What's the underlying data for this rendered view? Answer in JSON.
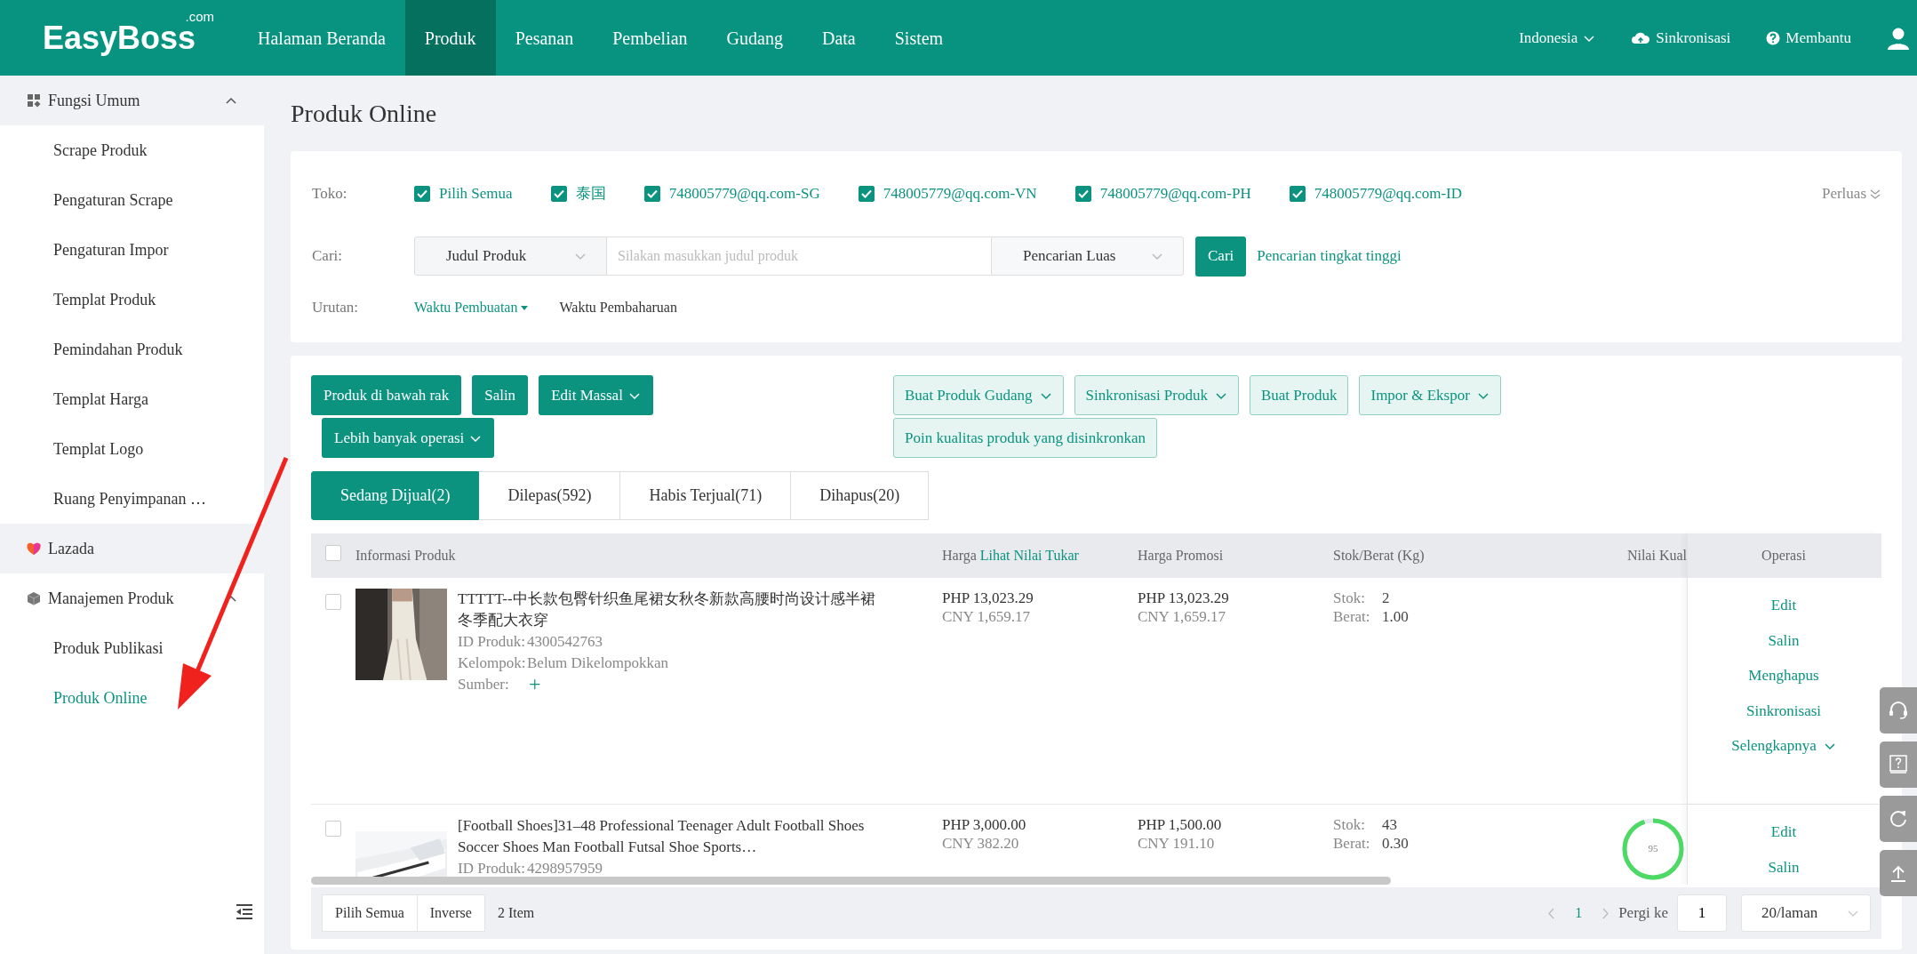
{
  "logo": {
    "text": "EasyBoss",
    "suffix": ".com"
  },
  "nav": [
    {
      "label": "Halaman Beranda",
      "selected": false
    },
    {
      "label": "Produk",
      "selected": true
    },
    {
      "label": "Pesanan",
      "selected": false
    },
    {
      "label": "Pembelian",
      "selected": false
    },
    {
      "label": "Gudang",
      "selected": false
    },
    {
      "label": "Data",
      "selected": false
    },
    {
      "label": "Sistem",
      "selected": false
    }
  ],
  "top_right": {
    "language": "Indonesia",
    "sync": "Sinkronisasi",
    "help": "Membantu"
  },
  "sidebar": {
    "groups": [
      {
        "label": "Fungsi Umum",
        "highlighted": true,
        "expanded": true,
        "children": [
          {
            "label": "Scrape Produk",
            "selected": false
          },
          {
            "label": "Pengaturan Scrape",
            "selected": false
          },
          {
            "label": "Pengaturan Impor",
            "selected": false
          },
          {
            "label": "Templat Produk",
            "selected": false
          },
          {
            "label": "Pemindahan Produk",
            "selected": false
          },
          {
            "label": "Templat Harga",
            "selected": false
          },
          {
            "label": "Templat Logo",
            "selected": false
          },
          {
            "label": "Ruang Penyimpanan …",
            "selected": false
          }
        ]
      },
      {
        "label": "Lazada",
        "highlighted": true
      },
      {
        "label": "Manajemen Produk",
        "highlighted": false,
        "expanded": true,
        "children": [
          {
            "label": "Produk Publikasi",
            "selected": false
          },
          {
            "label": "Produk Online",
            "selected": true
          }
        ]
      }
    ]
  },
  "page_title": "Produk Online",
  "filters": {
    "store_label": "Toko:",
    "stores": [
      {
        "label": "Pilih Semua",
        "checked": true
      },
      {
        "label": "泰国",
        "checked": true
      },
      {
        "label": "748005779@qq.com-SG",
        "checked": true
      },
      {
        "label": "748005779@qq.com-VN",
        "checked": true
      },
      {
        "label": "748005779@qq.com-PH",
        "checked": true
      },
      {
        "label": "748005779@qq.com-ID",
        "checked": true
      }
    ],
    "expand": "Perluas",
    "search_label": "Cari:",
    "field_select": "Judul Produk",
    "placeholder": "Silakan masukkan judul produk",
    "mode_select": "Pencarian Luas",
    "search_button": "Cari",
    "advanced_link": "Pencarian tingkat tinggi",
    "sort_label": "Urutan:",
    "sorts": [
      {
        "label": "Waktu Pembuatan",
        "selected": true
      },
      {
        "label": "Waktu Pembaharuan",
        "selected": false
      }
    ]
  },
  "actions": {
    "primary": [
      {
        "label": "Produk di bawah rak",
        "dropdown": false
      },
      {
        "label": "Salin",
        "dropdown": false
      },
      {
        "label": "Edit Massal",
        "dropdown": true
      },
      {
        "label": "Lebih banyak operasi",
        "dropdown": true
      }
    ],
    "secondary": [
      {
        "label": "Buat Produk Gudang",
        "dropdown": true
      },
      {
        "label": "Sinkronisasi Produk",
        "dropdown": true
      },
      {
        "label": "Buat Produk",
        "dropdown": false
      },
      {
        "label": "Impor & Ekspor",
        "dropdown": true
      },
      {
        "label": "Poin kualitas produk yang disinkronkan",
        "dropdown": false
      }
    ]
  },
  "tabs": [
    {
      "label": "Sedang Dijual(2)",
      "selected": true
    },
    {
      "label": "Dilepas(592)",
      "selected": false
    },
    {
      "label": "Habis Terjual(71)",
      "selected": false
    },
    {
      "label": "Dihapus(20)",
      "selected": false
    }
  ],
  "table": {
    "header_checked": false,
    "columns": [
      {
        "label": "Informasi Produk"
      },
      {
        "label": "Harga",
        "link": "Lihat Nilai Tukar"
      },
      {
        "label": "Harga Promosi"
      },
      {
        "label": "Stok/Berat (Kg)"
      },
      {
        "label": "Nilai Kual"
      },
      {
        "label": "Operasi"
      }
    ],
    "rows": [
      {
        "checked": false,
        "title": "TTTTT--中长款包臀针织鱼尾裙女秋冬新款高腰时尚设计感半裙冬季配大衣穿",
        "id_label": "ID Produk:",
        "id": "4300542763",
        "group_label": "Kelompok:",
        "group": "Belum Dikelompokkan",
        "source_label": "Sumber:",
        "add_icon": "+",
        "price": [
          "PHP 13,023.29",
          "CNY 1,659.17"
        ],
        "promo": [
          "PHP 13,023.29",
          "CNY 1,659.17"
        ],
        "stock_label": "Stok:",
        "stock": "2",
        "weight_label": "Berat:",
        "weight": "1.00",
        "operations": [
          {
            "label": "Edit",
            "dropdown": false
          },
          {
            "label": "Salin",
            "dropdown": false
          },
          {
            "label": "Menghapus",
            "dropdown": false
          },
          {
            "label": "Sinkronisasi",
            "dropdown": false
          },
          {
            "label": "Selengkapnya",
            "dropdown": true
          }
        ]
      },
      {
        "checked": false,
        "title": "[Football Shoes]31–48 Professional Teenager Adult Football Shoes Soccer Shoes Man Football Futsal Shoe Sports…",
        "id_label": "ID Produk:",
        "id": "4298957959",
        "price": [
          "PHP 3,000.00",
          "CNY 382.20"
        ],
        "promo": [
          "PHP 1,500.00",
          "CNY 191.10"
        ],
        "stock_label": "Stok:",
        "stock": "43",
        "weight_label": "Berat:",
        "weight": "0.30",
        "quality": {
          "score": "95",
          "level": 0.95
        },
        "operations": [
          {
            "label": "Edit",
            "dropdown": false
          },
          {
            "label": "Salin",
            "dropdown": false
          }
        ]
      }
    ]
  },
  "footer": {
    "select_all": "Pilih Semua",
    "inverse": "Inverse",
    "count": "2 Item",
    "page": "1",
    "goto_label": "Pergi ke",
    "goto_value": "1",
    "page_size": "20/laman"
  }
}
